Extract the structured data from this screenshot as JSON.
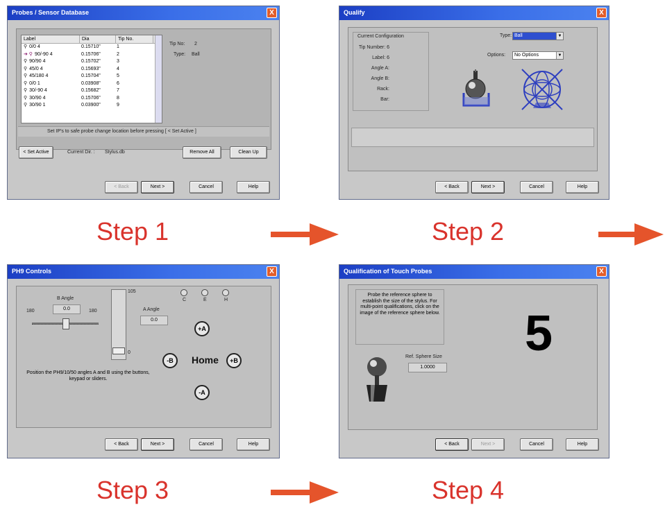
{
  "steps": [
    {
      "label": "Step 1"
    },
    {
      "label": "Step 2"
    },
    {
      "label": "Step 3"
    },
    {
      "label": "Step 4"
    }
  ],
  "common": {
    "back": "< Back",
    "next": "Next >",
    "cancel": "Cancel",
    "help": "Help",
    "close": "X"
  },
  "win1": {
    "title": "Probes / Sensor Database",
    "headers": [
      "Label",
      "Dia",
      "Tip No."
    ],
    "rows": [
      [
        "0/0 4",
        "0.15710\"",
        "1"
      ],
      [
        "90/-90 4",
        "0.15706\"",
        "2"
      ],
      [
        "90/90 4",
        "0.15702\"",
        "3"
      ],
      [
        "45/0 4",
        "0.15693\"",
        "4"
      ],
      [
        "45/180 4",
        "0.15704\"",
        "5"
      ],
      [
        "0/0 1",
        "0.03908\"",
        "6"
      ],
      [
        "30/-90 4",
        "0.15682\"",
        "7"
      ],
      [
        "30/90 4",
        "0.15706\"",
        "8"
      ],
      [
        "30/90 1",
        "0.03900\"",
        "9"
      ]
    ],
    "tip_no_label": "Tip No:",
    "tip_no_value": "2",
    "type_label": "Type:",
    "type_value": "Ball",
    "hint": "Set IP's to safe probe change location before pressing  [ < Set Active ]",
    "set_active": "< Set Active",
    "current_dir_label": "Current Dir. :",
    "current_dir_value": "Stylus.db",
    "remove_all": "Remove All",
    "clean_up": "Clean Up"
  },
  "win2": {
    "title": "Qualify",
    "group_title": "Current Configuration",
    "fields": [
      "Tip Number:  6",
      "Label:  6",
      "Angle A:",
      "Angle B:",
      "Rack:",
      "Bar:"
    ],
    "type_label": "Type:",
    "type_value": "Ball",
    "options_label": "Options:",
    "options_value": "No Options"
  },
  "win3": {
    "title": "PH9 Controls",
    "b_angle_label": "B Angle",
    "b_angle_value": "0.0",
    "slider_min": "180",
    "slider_max": "180",
    "vslider_top": "105",
    "vslider_bottom": "0",
    "a_angle_label": "A Angle",
    "a_angle_value": "0.0",
    "radios": [
      "C",
      "E",
      "H"
    ],
    "home": "Home",
    "instructions": "Position the PH9/10/50 angles A and B using the buttons, keypad or sliders.",
    "arrow_up": "+A",
    "arrow_down": "-A",
    "arrow_left": "-B",
    "arrow_right": "+B"
  },
  "win4": {
    "title": "Qualification of Touch Probes",
    "instructions": "Probe the reference sphere to establish the size of the stylus. For multi-point qualifications, click on the image of the reference sphere below.",
    "countdown": "5",
    "ref_sphere_label": "Ref. Sphere Size",
    "ref_sphere_value": "1.0000"
  }
}
